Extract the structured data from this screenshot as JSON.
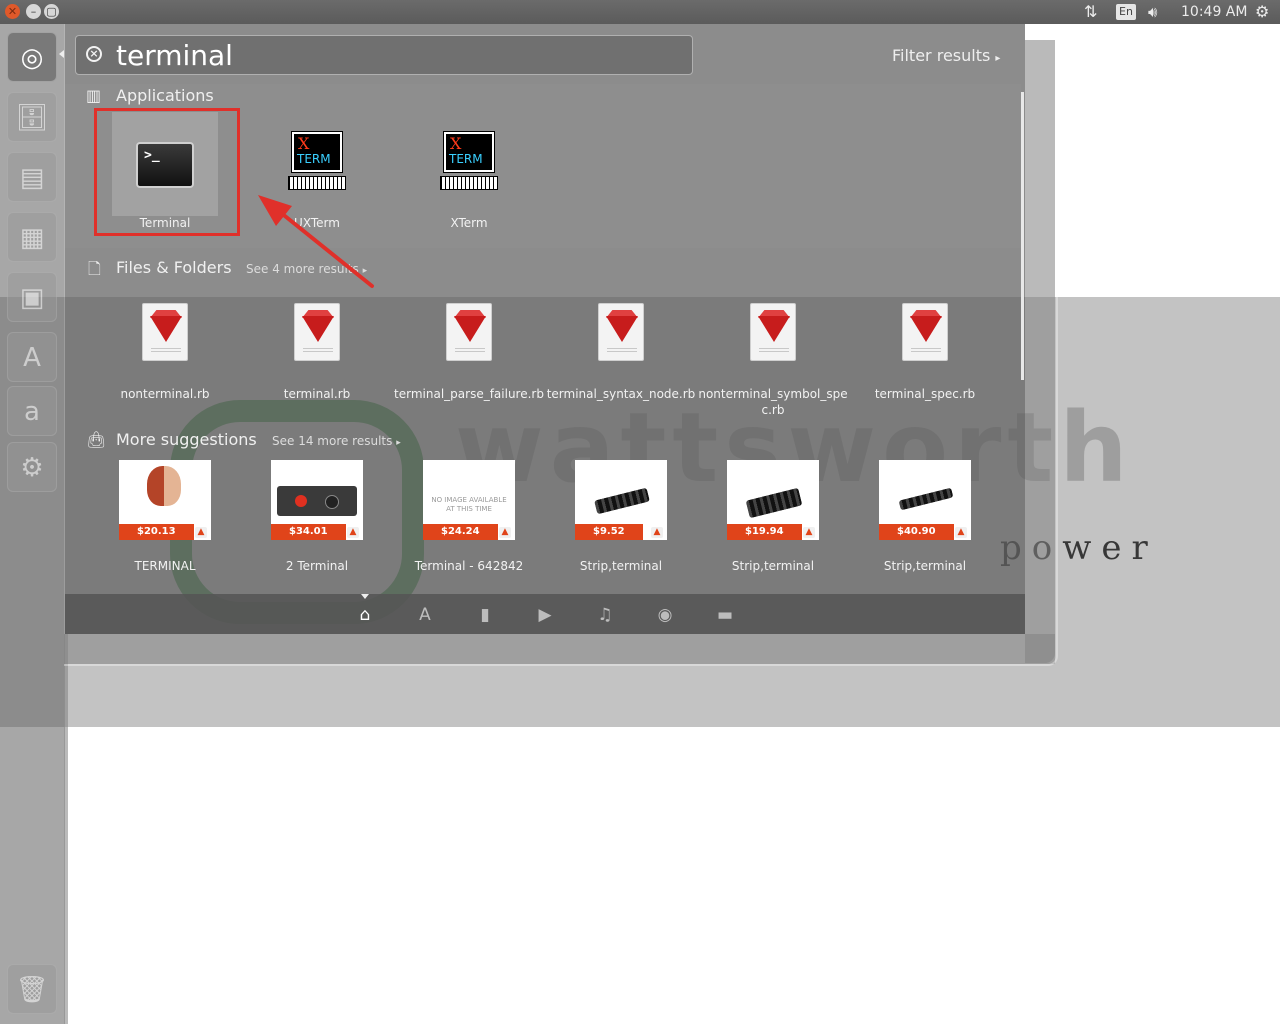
{
  "panel": {
    "keyboard_layout": "En",
    "clock": "10:49 AM"
  },
  "dash": {
    "search": {
      "value": "terminal"
    },
    "filter_label": "Filter results"
  },
  "categories": {
    "applications": {
      "title": "Applications",
      "items": [
        {
          "label": "Terminal",
          "icon": "terminal-icon"
        },
        {
          "label": "UXTerm",
          "icon": "xterm-icon"
        },
        {
          "label": "XTerm",
          "icon": "xterm-icon"
        }
      ]
    },
    "files": {
      "title": "Files & Folders",
      "see_more": "See 4 more results",
      "items": [
        {
          "label": "nonterminal.rb"
        },
        {
          "label": "terminal.rb"
        },
        {
          "label": "terminal_parse_failure.rb"
        },
        {
          "label": "terminal_syntax_node.rb"
        },
        {
          "label": "nonterminal_symbol_spec.rb"
        },
        {
          "label": "terminal_spec.rb"
        }
      ]
    },
    "suggestions": {
      "title": "More suggestions",
      "see_more": "See 14 more results",
      "no_image_text": "NO IMAGE AVAILABLE AT THIS TIME",
      "items": [
        {
          "label": "TERMINAL",
          "price": "$20.13"
        },
        {
          "label": "2 Terminal",
          "price": "$34.01"
        },
        {
          "label": "Terminal - 642842",
          "price": "$24.24"
        },
        {
          "label": "Strip,terminal",
          "price": "$9.52"
        },
        {
          "label": "Strip,terminal",
          "price": "$19.94"
        },
        {
          "label": "Strip,terminal",
          "price": "$40.90"
        }
      ]
    }
  },
  "xterm_icon_text": {
    "x": "X",
    "term": "TERM"
  },
  "background": {
    "brand": "wattsworth",
    "tagline": "power"
  },
  "colors": {
    "highlight": "#e0302a",
    "price_tag": "#e0441a",
    "accent_close": "#e0592a"
  },
  "lenses": [
    "home-icon",
    "applications-icon",
    "files-icon",
    "video-icon",
    "music-icon",
    "photo-icon",
    "social-icon"
  ]
}
